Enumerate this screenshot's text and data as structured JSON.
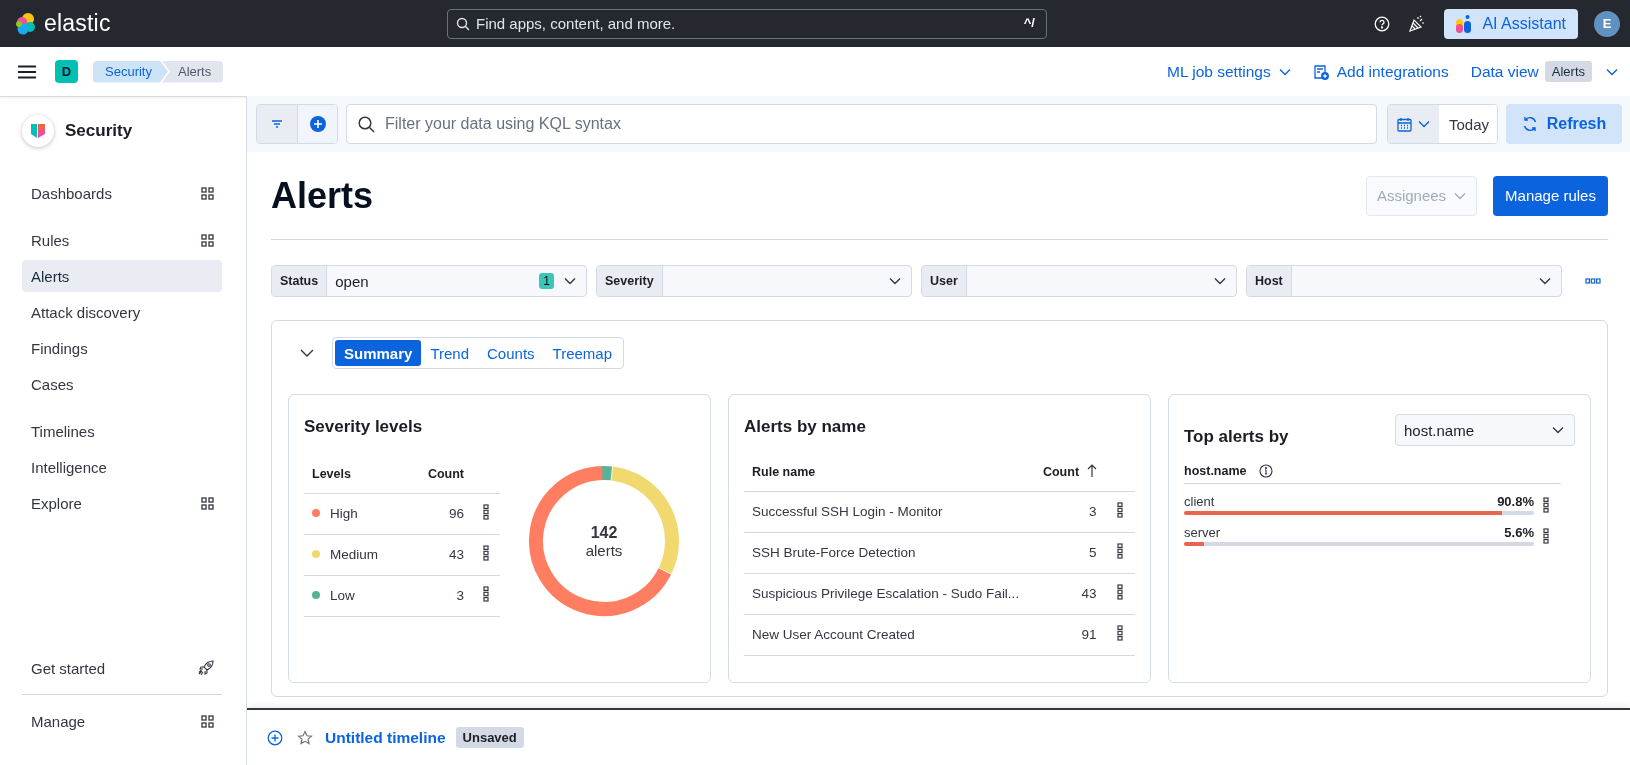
{
  "header": {
    "logo_text": "elastic",
    "search": {
      "placeholder": "Find apps, content, and more.",
      "shortcut": "^/"
    },
    "ai_button": "AI Assistant",
    "avatar": "E"
  },
  "nav_bar": {
    "space": "D",
    "breadcrumbs": [
      {
        "label": "Security",
        "selected": false
      },
      {
        "label": "Alerts",
        "selected": true
      }
    ],
    "actions": [
      {
        "kind": "dropdown",
        "label": "ML job settings"
      },
      {
        "kind": "add",
        "label": "Add integrations"
      },
      {
        "kind": "dataview",
        "label": "Data view",
        "badge": "Alerts"
      }
    ]
  },
  "sidebar": {
    "title": "Security",
    "groups": [
      [
        {
          "label": "Dashboards",
          "selected": false,
          "kind": "panel"
        }
      ],
      [
        {
          "label": "Rules",
          "selected": false,
          "kind": "panel"
        },
        {
          "label": "Alerts",
          "selected": true,
          "kind": "link"
        },
        {
          "label": "Attack discovery",
          "selected": false,
          "kind": "link"
        },
        {
          "label": "Findings",
          "selected": false,
          "kind": "link"
        },
        {
          "label": "Cases",
          "selected": false,
          "kind": "link"
        }
      ],
      [
        {
          "label": "Timelines",
          "selected": false,
          "kind": "link"
        },
        {
          "label": "Intelligence",
          "selected": false,
          "kind": "link"
        },
        {
          "label": "Explore",
          "selected": false,
          "kind": "panel"
        }
      ]
    ],
    "footer": [
      {
        "label": "Get started",
        "selected": false,
        "kind": "guide"
      },
      {
        "label": "Manage",
        "selected": false,
        "kind": "panel"
      }
    ]
  },
  "query_bar": {
    "placeholder": "Filter your data using KQL syntax",
    "date": "Today",
    "refresh": "Refresh"
  },
  "page": {
    "title": "Alerts",
    "assignees": {
      "label": "Assignees",
      "disabled": true
    },
    "manage_rules": "Manage rules"
  },
  "filters": [
    {
      "label": "Status",
      "value": "open",
      "count": "1"
    },
    {
      "label": "Severity"
    },
    {
      "label": "User"
    },
    {
      "label": "Host"
    }
  ],
  "summary": {
    "expanded": true,
    "tabs": [
      {
        "label": "Summary",
        "selected": true
      },
      {
        "label": "Trend",
        "selected": false
      },
      {
        "label": "Counts",
        "selected": false
      },
      {
        "label": "Treemap",
        "selected": false
      }
    ],
    "severity": {
      "title": "Severity levels",
      "columns": [
        "Levels",
        "Count"
      ],
      "total": "142",
      "total_label": "alerts",
      "levels": [
        {
          "name": "High",
          "count": "96",
          "color": "#ff7e62"
        },
        {
          "name": "Medium",
          "count": "43",
          "color": "#f1d86f"
        },
        {
          "name": "Low",
          "count": "3",
          "color": "#54b399"
        }
      ]
    },
    "alerts_by_name": {
      "title": "Alerts by name",
      "columns": [
        "Rule name",
        "Count"
      ],
      "rows": [
        {
          "name": "Successful SSH Login - Monitor",
          "count": "3"
        },
        {
          "name": "SSH Brute-Force Detection",
          "count": "5"
        },
        {
          "name": "Suspicious Privilege Escalation - Sudo Fail...",
          "count": "43"
        },
        {
          "name": "New User Account Created",
          "count": "91"
        }
      ]
    },
    "top_alerts": {
      "title": "Top alerts by",
      "field": "host.name",
      "column": "host.name",
      "rows": [
        {
          "name": "client",
          "percent": "90.8%",
          "level": 0.908
        },
        {
          "name": "server",
          "percent": "5.6%",
          "level": 0.056
        }
      ]
    }
  },
  "timeline": {
    "title": "Untitled timeline",
    "badge": "Unsaved"
  }
}
